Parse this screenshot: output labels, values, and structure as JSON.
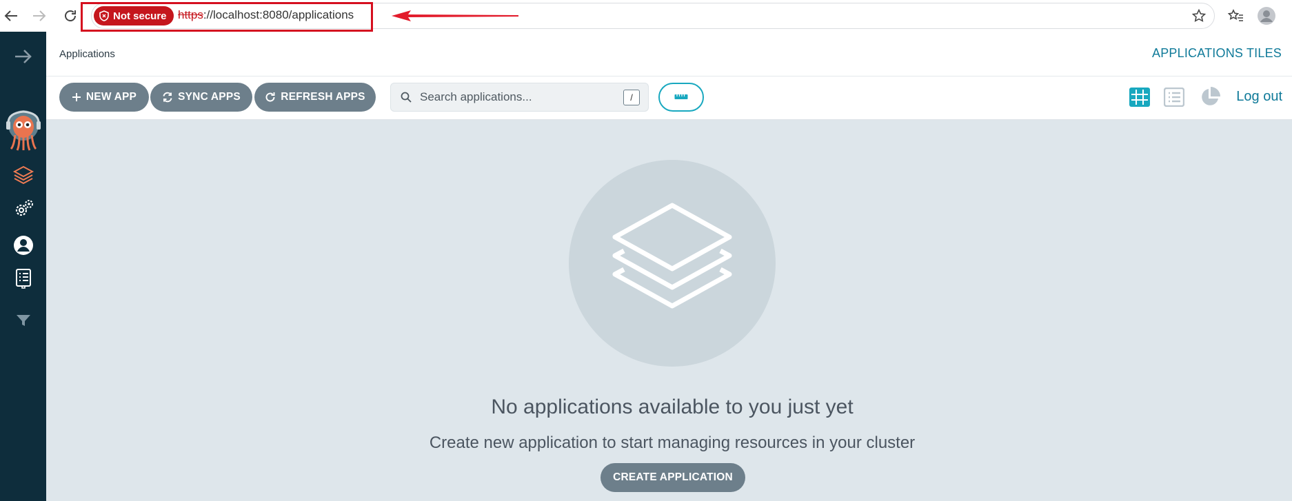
{
  "browser": {
    "security_label": "Not secure",
    "url_scheme": "https",
    "url_rest": "://localhost:8080/applications"
  },
  "header": {
    "title": "Applications",
    "view_title": "APPLICATIONS TILES"
  },
  "toolbar": {
    "new_app_label": "NEW APP",
    "sync_apps_label": "SYNC APPS",
    "refresh_apps_label": "REFRESH APPS",
    "search_placeholder": "Search applications...",
    "search_shortcut": "/",
    "logout_label": "Log out"
  },
  "empty_state": {
    "title": "No applications available to you just yet",
    "subtitle": "Create new application to start managing resources in your cluster",
    "create_label": "CREATE APPLICATION"
  },
  "colors": {
    "sidebar_bg": "#0e2d3c",
    "accent": "#0f7a99",
    "button_bg": "#6d7f8b",
    "main_bg": "#dee6eb",
    "highlight": "#d50f1f"
  }
}
